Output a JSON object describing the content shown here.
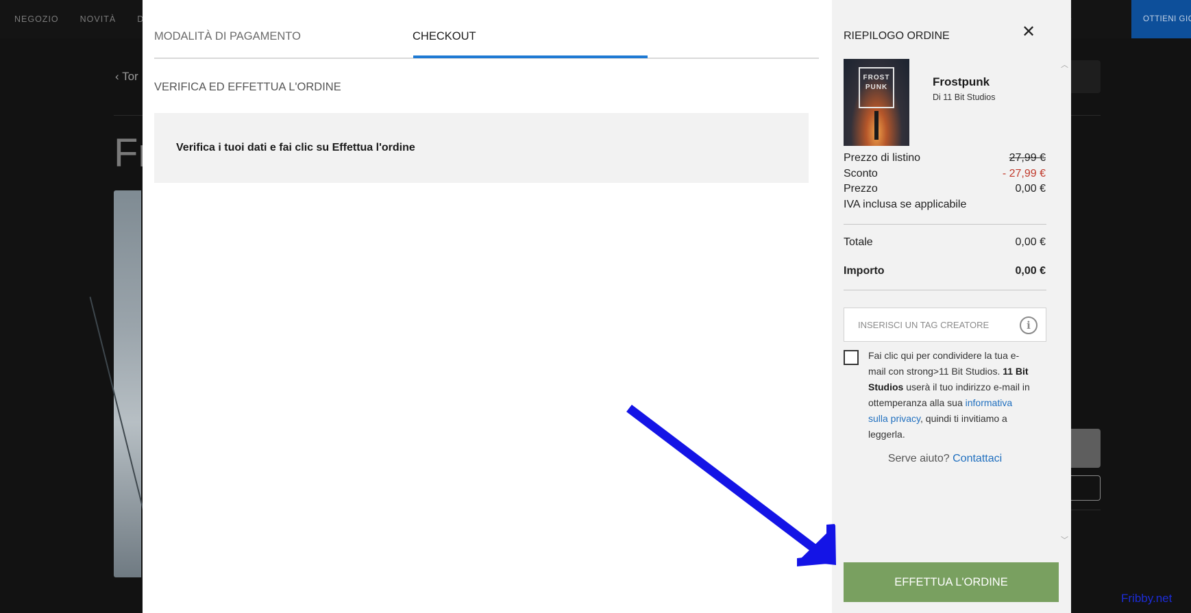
{
  "background": {
    "nav_items": [
      "NEGOZIO",
      "NOVITÀ",
      "DI"
    ],
    "get_button": "OTTIENI GIOCHI",
    "back_link": "Tor",
    "page_title_partial": "Fr"
  },
  "modal": {
    "tabs": [
      {
        "label": "MODALITÀ DI PAGAMENTO",
        "active": false
      },
      {
        "label": "CHECKOUT",
        "active": true
      }
    ],
    "section_title": "VERIFICA ED EFFETTUA L'ORDINE",
    "info_message": "Verifica i tuoi dati e fai clic su Effettua l'ordine"
  },
  "summary": {
    "title": "RIEPILOGO ORDINE",
    "close_icon": "close-icon",
    "cover_logo_text": "FROST PUNK",
    "game": {
      "name": "Frostpunk",
      "developer": "Di 11 Bit Studios"
    },
    "rows": {
      "list_price_label": "Prezzo di listino",
      "list_price_value": "27,99 €",
      "discount_label": "Sconto",
      "discount_value": "- 27,99 €",
      "price_label": "Prezzo",
      "price_value": "0,00 €",
      "vat_label": "IVA inclusa se applicabile",
      "total_label": "Totale",
      "total_value": "0,00 €",
      "amount_label": "Importo",
      "amount_value": "0,00 €"
    },
    "creator_tag_placeholder": "INSERISCI UN TAG CREATORE",
    "consent": {
      "part1": "Fai clic qui per condividere la tua e-mail con strong>11 Bit Studios. ",
      "bold": "11 Bit Studios",
      "part2": " userà il tuo indirizzo e-mail in ottemperanza alla sua ",
      "link": "informativa sulla privacy",
      "part3": ", quindi ti invitiamo a leggerla."
    },
    "help_text": "Serve aiuto?",
    "help_link": "Contattaci",
    "order_button": "EFFETTUA L'ORDINE"
  },
  "watermark": "Fribby.net",
  "colors": {
    "accent_blue": "#1f7ad3",
    "order_button_green": "#79a060",
    "discount_red": "#c0392b",
    "annotation_arrow": "#1414e6"
  }
}
